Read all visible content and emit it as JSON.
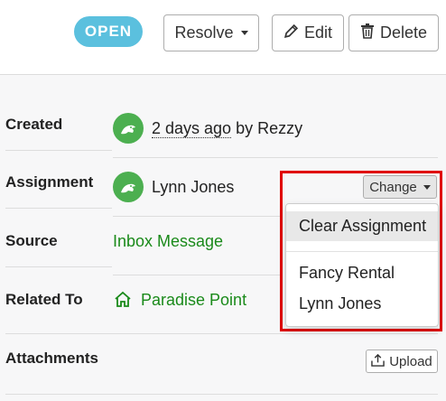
{
  "header": {
    "status_badge": "OPEN",
    "resolve_label": "Resolve",
    "edit_label": "Edit",
    "delete_label": "Delete"
  },
  "fields": {
    "created": {
      "label": "Created",
      "relative_time": "2 days ago",
      "by_text": "by Rezzy"
    },
    "assignment": {
      "label": "Assignment",
      "assignee": "Lynn Jones",
      "change_label": "Change"
    },
    "source": {
      "label": "Source",
      "value": "Inbox Message"
    },
    "related_to": {
      "label": "Related To",
      "value": "Paradise Point",
      "icon": "home-icon"
    },
    "attachments": {
      "label": "Attachments",
      "upload_label": "Upload"
    }
  },
  "assignment_dropdown": {
    "clear_label": "Clear Assignment",
    "options": [
      "Fancy Rental",
      "Lynn Jones"
    ]
  },
  "colors": {
    "badge": "#5bc0de",
    "link_green": "#1a8a1a",
    "avatar_green": "#4caf50",
    "highlight_red": "#e00000"
  }
}
